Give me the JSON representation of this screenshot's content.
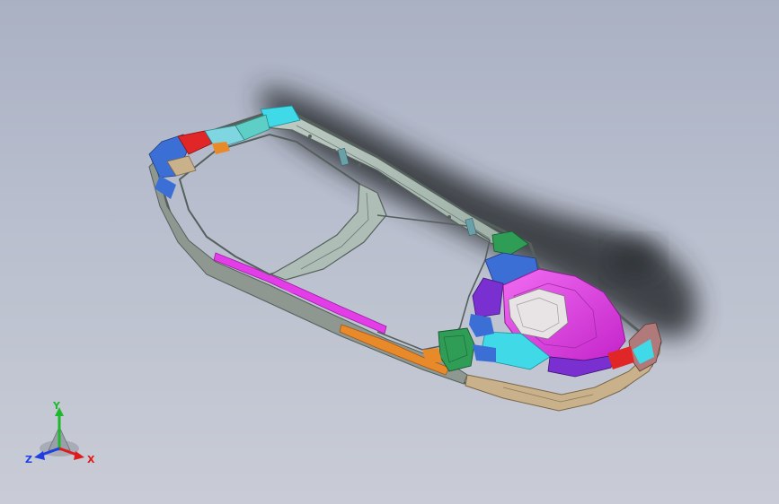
{
  "viewport": {
    "background_top": "#aab1c3",
    "background_bottom": "#c9ccd6"
  },
  "model": {
    "icon": "car-body-frame-model",
    "colors": {
      "frame_gray": "#b9c6bf",
      "frame_edge": "#55605c",
      "cyan": "#3fd9e8",
      "blue": "#3b6fd6",
      "red": "#e02626",
      "magenta": "#e23de6",
      "orange": "#e8892a",
      "green": "#2f9d55",
      "tan": "#c9b18b",
      "purple": "#7a2fd1",
      "shadow": "#2b2d33"
    }
  },
  "triad": {
    "icon": "xyz-axis-triad",
    "x_label": "X",
    "y_label": "Y",
    "z_label": "Z",
    "x_color": "#e01b1b",
    "y_color": "#1db82d",
    "z_color": "#1f3fe0"
  }
}
